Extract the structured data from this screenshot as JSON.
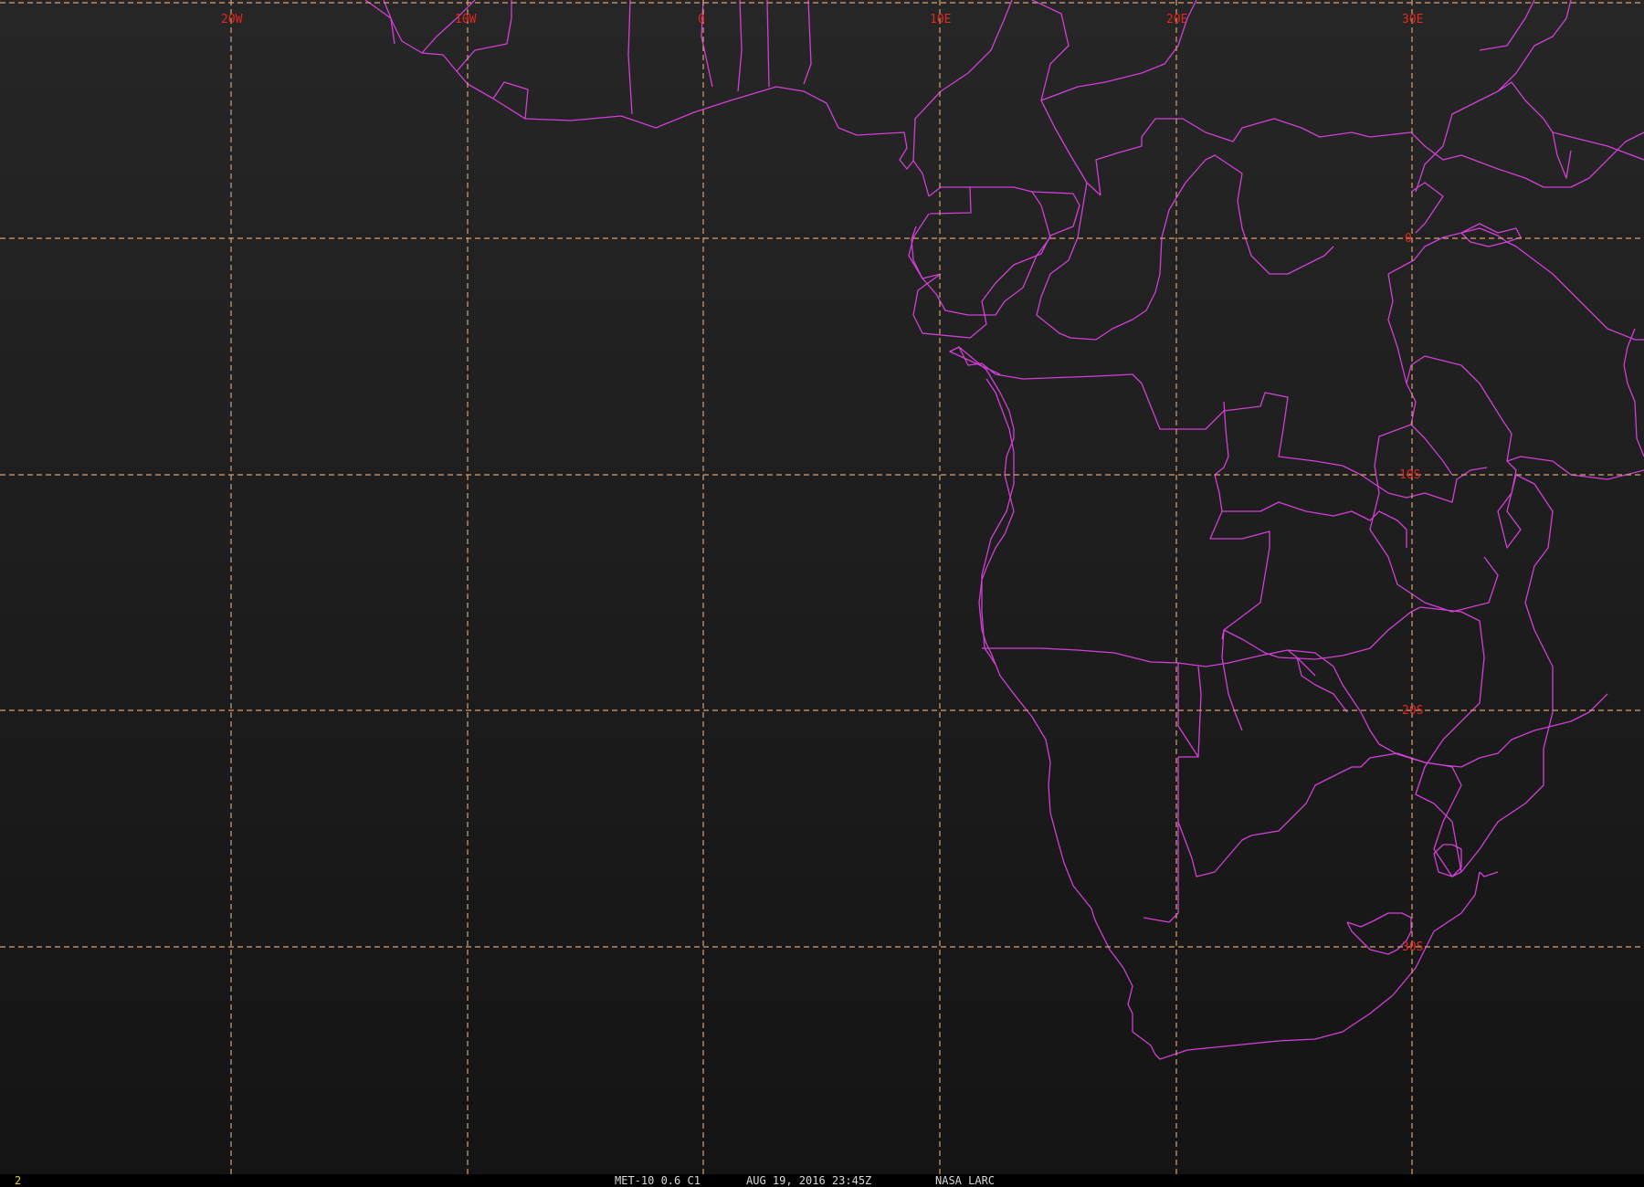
{
  "map": {
    "longitude_labels": [
      "20W",
      "10W",
      "0",
      "10E",
      "20E",
      "30E"
    ],
    "latitude_labels": [
      "0",
      "10S",
      "20S",
      "30S"
    ],
    "colors": {
      "background_top": "#242424",
      "background_bottom": "#161616",
      "grid": "#d9a070",
      "borders": "#d23fd6",
      "grid_labels": "#e0281e"
    }
  },
  "status_bar": {
    "frame_number": "2",
    "satellite": "MET-10 0.6 C1",
    "datetime": "AUG 19, 2016 23:45Z",
    "source": "NASA LARC",
    "colors": {
      "frame_number": "#e8d000",
      "caption": "#d8d8d8"
    }
  }
}
